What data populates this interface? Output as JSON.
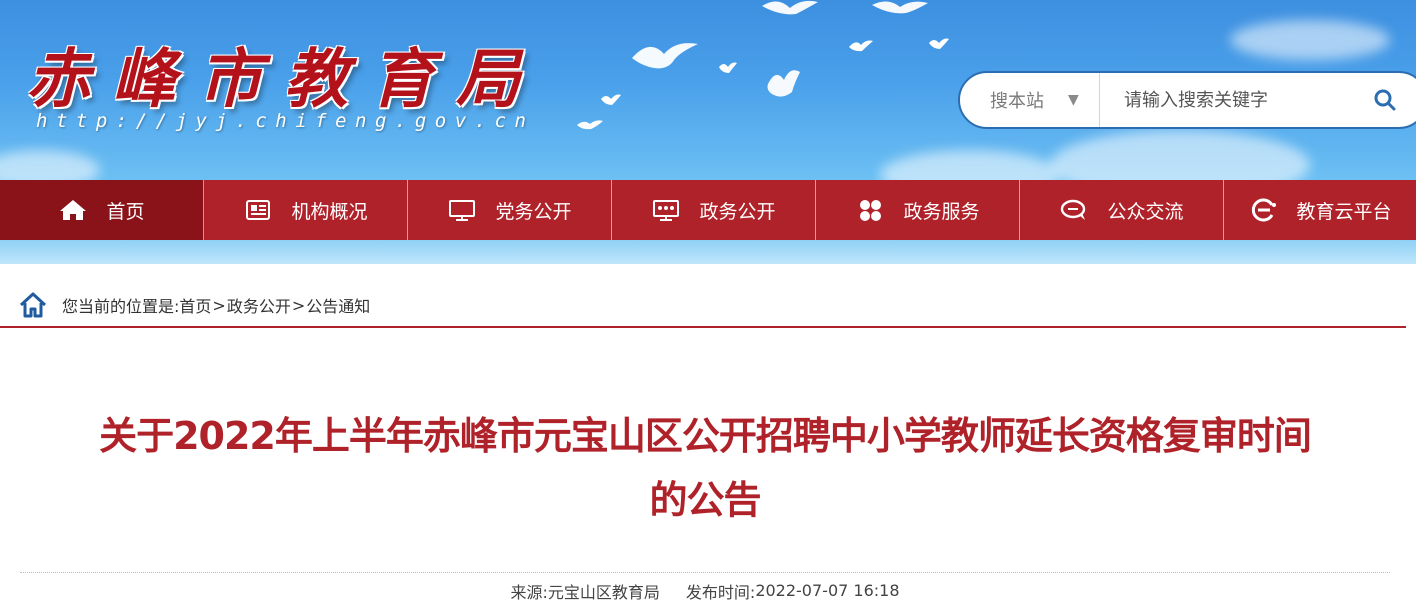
{
  "site": {
    "logo_text": "赤峰市教育局",
    "url_text": "http://jyj.chifeng.gov.cn"
  },
  "search": {
    "scope_label": "搜本站",
    "placeholder": "请输入搜索关键字",
    "value": ""
  },
  "nav": {
    "items": [
      {
        "label": "首页",
        "icon": "home-icon",
        "active": true
      },
      {
        "label": "机构概况",
        "icon": "newspaper-icon",
        "active": false
      },
      {
        "label": "党务公开",
        "icon": "monitor-icon",
        "active": false
      },
      {
        "label": "政务公开",
        "icon": "meeting-icon",
        "active": false
      },
      {
        "label": "政务服务",
        "icon": "grid-icon",
        "active": false
      },
      {
        "label": "公众交流",
        "icon": "chat-icon",
        "active": false
      },
      {
        "label": "教育云平台",
        "icon": "cloud-e-icon",
        "active": false
      }
    ]
  },
  "breadcrumb": {
    "prefix": "您当前的位置是:",
    "items": [
      "首页",
      "政务公开",
      "公告通知"
    ],
    "separator": ">"
  },
  "article": {
    "title_line1": "关于2022年上半年赤峰市元宝山区公开招聘中小学教师延长资格复审时间",
    "title_line2": "的公告",
    "source_label": "来源:",
    "source_value": "元宝山区教育局",
    "date_label": "发布时间:",
    "date_value": "2022-07-07 16:18"
  },
  "colors": {
    "brand_red": "#b0222a",
    "nav_active": "#8a1219",
    "banner_blue": "#4aa0ea",
    "search_border": "#2c6db2"
  }
}
